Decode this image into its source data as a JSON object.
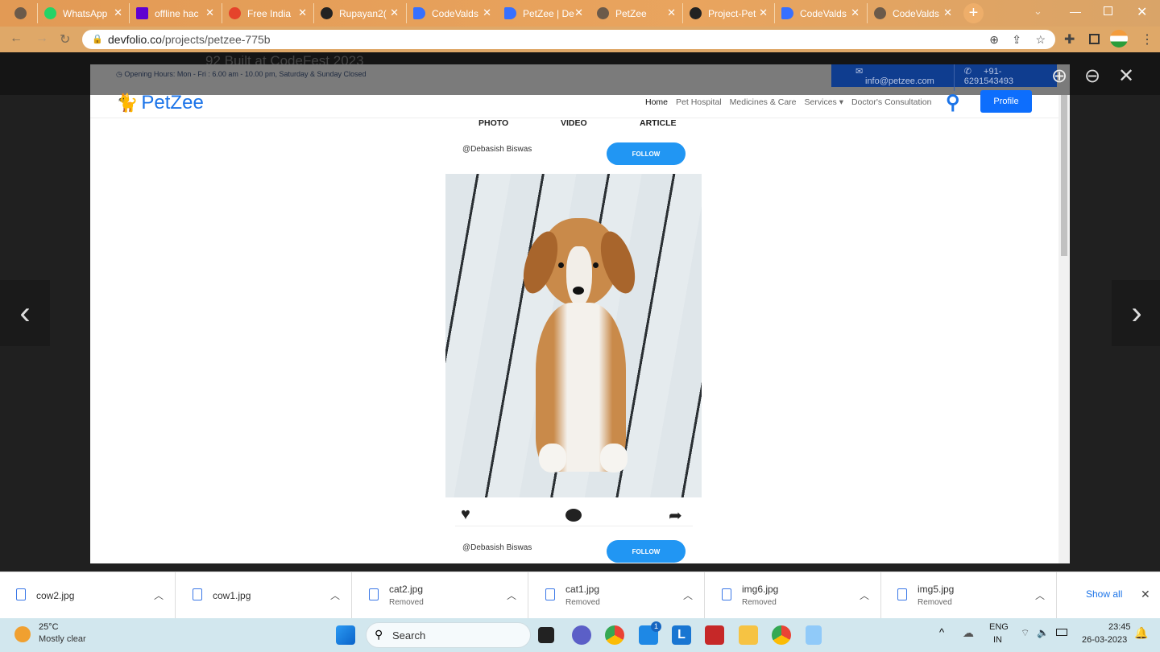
{
  "browser": {
    "tabs": [
      {
        "label": "",
        "icon": "globe-icon"
      },
      {
        "label": "WhatsApp",
        "icon": "whatsapp-icon"
      },
      {
        "label": "offline hac",
        "icon": "yahoo-icon"
      },
      {
        "label": "Free India",
        "icon": "edge-e-icon"
      },
      {
        "label": "Rupayan2(",
        "icon": "github-icon"
      },
      {
        "label": "CodeValds",
        "icon": "devfolio-icon"
      },
      {
        "label": "PetZee | De",
        "icon": "devfolio-icon"
      },
      {
        "label": "PetZee",
        "icon": "globe-icon"
      },
      {
        "label": "Project-Pet",
        "icon": "github-icon"
      },
      {
        "label": "CodeValds",
        "icon": "devfolio-icon"
      },
      {
        "label": "CodeValds",
        "icon": "globe-icon"
      }
    ],
    "url_domain": "devfolio.co",
    "url_path": "/projects/petzee-775b"
  },
  "background": {
    "text": "92        Built at CodeFest 2023"
  },
  "site": {
    "hours": "Opening Hours: Mon - Fri : 6.00 am - 10.00 pm, Saturday & Sunday Closed",
    "email": "info@petzee.com",
    "phone": "+91-6291543493",
    "logo": "PetZee",
    "nav": [
      "Home",
      "Pet Hospital",
      "Medicines & Care",
      "Services ▾",
      "Doctor's Consultation"
    ],
    "profile": "Profile",
    "media_tabs": [
      "PHOTO",
      "VIDEO",
      "ARTICLE"
    ],
    "posts": [
      {
        "user": "@Debasish Biswas",
        "follow": "FOLLOW"
      },
      {
        "user": "@Debasish Biswas",
        "follow": "FOLLOW"
      }
    ]
  },
  "downloads": [
    {
      "name": "cow2.jpg",
      "status": ""
    },
    {
      "name": "cow1.jpg",
      "status": ""
    },
    {
      "name": "cat2.jpg",
      "status": "Removed"
    },
    {
      "name": "cat1.jpg",
      "status": "Removed"
    },
    {
      "name": "img6.jpg",
      "status": "Removed"
    },
    {
      "name": "img5.jpg",
      "status": "Removed"
    }
  ],
  "show_all": "Show all",
  "taskbar": {
    "temp": "25°C",
    "weather": "Mostly clear",
    "search": "Search",
    "lang1": "ENG",
    "lang2": "IN",
    "time": "23:45",
    "date": "26-03-2023",
    "mail_badge": "1"
  }
}
